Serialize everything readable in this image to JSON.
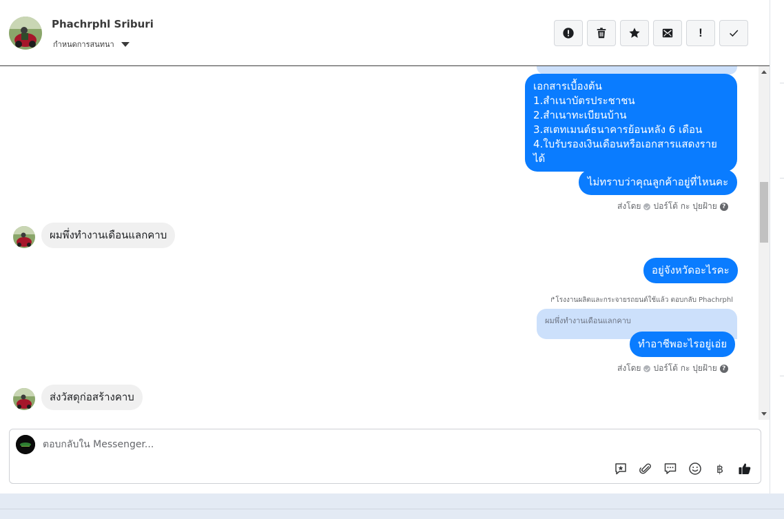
{
  "header": {
    "contact_name": "Phachrphl Sriburi",
    "label_dropdown": "กำหนดการสนทนา",
    "toolbar": [
      {
        "name": "alert-circle-icon"
      },
      {
        "name": "trash-icon"
      },
      {
        "name": "star-icon"
      },
      {
        "name": "mark-unread-icon"
      },
      {
        "name": "exclamation-icon",
        "glyph": "!"
      },
      {
        "name": "checkmark-icon"
      }
    ]
  },
  "messages": {
    "docs_bubble": {
      "lines": [
        "เอกสารเบื้องต้น",
        "1.สำเนาบัตรประชาชน",
        "2.สำเนาทะเบียนบ้าน",
        "3.สเตทเมนต์ธนาคารย้อนหลัง 6 เดือน",
        "4.ใบรับรองเงินเดือนหรือเอกสารแสดงรายได้"
      ]
    },
    "ask_location": "ไม่ทราบว่าคุณลูกค้าอยู่ที่ไหนคะ",
    "sent_by_1": {
      "prefix": "ส่งโดย",
      "agent": "ปอร์โต้ กะ ปุยฝ้าย"
    },
    "customer_1": "ผมพึ่งทำงานเดือนแลกคาบ",
    "ask_province": "อยู่จังหวัดอะไรคะ",
    "reply_meta": "โรงงานผลิตและกระจายรถยนต์ใช้แล้ว ตอบกลับ Phachrphl",
    "reply_quote": "ผมพึ่งทำงานเดือนแลกคาบ",
    "ask_job": "ทำอาชีพอะไรอยู่เอ่ย",
    "sent_by_2": {
      "prefix": "ส่งโดย",
      "agent": "ปอร์โต้ กะ ปุยฝ้าย"
    },
    "customer_2": "ส่งวัสดุก่อสร้างคาบ"
  },
  "composer": {
    "placeholder": "ตอบกลับใน Messenger...",
    "tools": [
      {
        "name": "saved-reply-icon"
      },
      {
        "name": "attachment-icon"
      },
      {
        "name": "chat-bubble-icon"
      },
      {
        "name": "emoji-icon"
      },
      {
        "name": "baht-icon",
        "glyph": "฿"
      },
      {
        "name": "thumbs-up-icon"
      }
    ]
  },
  "colors": {
    "outgoing": "#0a7cff",
    "incoming": "#f0f0f0",
    "quote": "#cce0fb"
  }
}
